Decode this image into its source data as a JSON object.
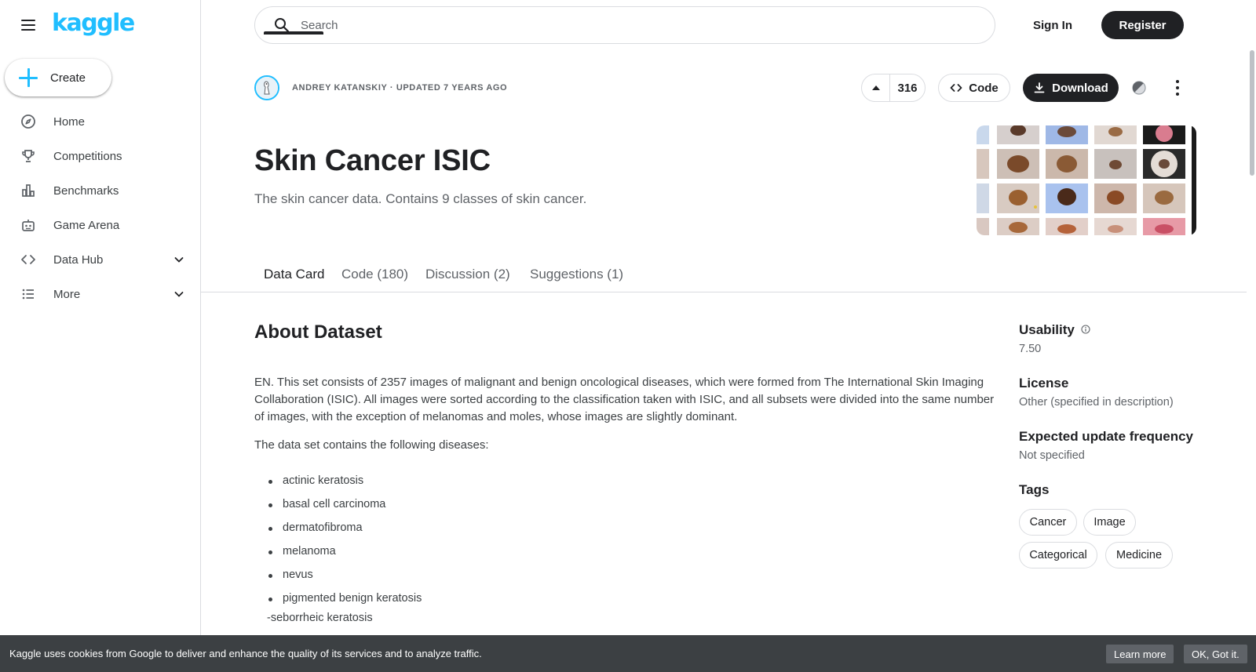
{
  "app": {
    "logo": "kaggle",
    "brand_color": "#20beff"
  },
  "sidebar": {
    "create_label": "Create",
    "items": [
      {
        "label": "Home",
        "icon": "compass-icon"
      },
      {
        "label": "Competitions",
        "icon": "trophy-icon"
      },
      {
        "label": "Benchmarks",
        "icon": "bar-chart-icon"
      },
      {
        "label": "Game Arena",
        "icon": "robot-icon"
      },
      {
        "label": "Data Hub",
        "icon": "code-icon",
        "expandable": true
      },
      {
        "label": "More",
        "icon": "list-icon",
        "expandable": true
      }
    ]
  },
  "header": {
    "search_placeholder": "Search",
    "signin_label": "Sign In",
    "register_label": "Register"
  },
  "dataset": {
    "meta": "ANDREY KATANSKIY · UPDATED 7 YEARS AGO",
    "votes": "316",
    "code_label": "Code",
    "download_label": "Download",
    "title": "Skin Cancer ISIC",
    "subtitle": "The skin cancer data. Contains 9 classes of skin cancer."
  },
  "tabs": [
    {
      "label": "Data Card",
      "active": true
    },
    {
      "label": "Code (180)",
      "active": false
    },
    {
      "label": "Discussion (2)",
      "active": false
    },
    {
      "label": "Suggestions (1)",
      "active": false
    }
  ],
  "about": {
    "title": "About Dataset",
    "paragraph": "EN. This set consists of 2357 images of malignant and benign oncological diseases, which were formed from The International Skin Imaging Collaboration (ISIC). All images were sorted according to the classification taken with ISIC, and all subsets were divided into the same number of images, with the exception of melanomas and moles, whose images are slightly dominant.",
    "list_intro": "The data set contains the following diseases:",
    "diseases": [
      "actinic keratosis",
      "basal cell carcinoma",
      "dermatofibroma",
      "melanoma",
      "nevus",
      "pigmented benign keratosis"
    ],
    "extra_line": "-seborrheic keratosis"
  },
  "panel": {
    "usability_label": "Usability",
    "usability_value": "7.50",
    "license_label": "License",
    "license_value": "Other (specified in description)",
    "frequency_label": "Expected update frequency",
    "frequency_value": "Not specified",
    "tags_label": "Tags",
    "tags": [
      "Cancer",
      "Image",
      "Categorical",
      "Medicine"
    ]
  },
  "cookie": {
    "text": "Kaggle uses cookies from Google to deliver and enhance the quality of its services and to analyze traffic.",
    "learn_label": "Learn more",
    "ok_label": "OK, Got it."
  }
}
